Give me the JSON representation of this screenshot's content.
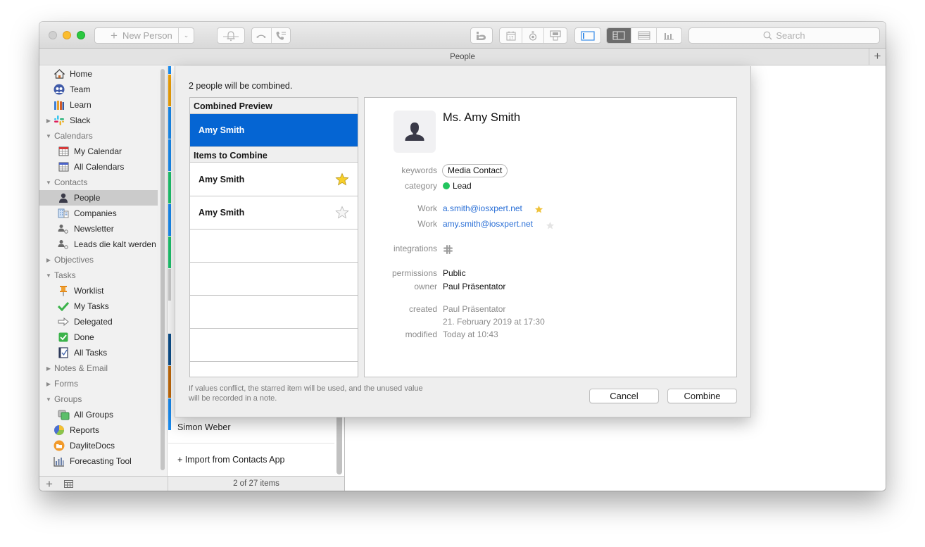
{
  "window": {
    "title": "People",
    "controls": [
      "close",
      "minimize",
      "maximize"
    ]
  },
  "toolbar": {
    "new_person_label": "New Person",
    "new_person_icon": "plus-icon",
    "dropdown_icon": "chevron-down-icon",
    "notify_icon": "bell-icon",
    "call_icons": [
      "hang-up-icon",
      "call-log-icon"
    ],
    "daylite_icon": "daylite-logo-icon",
    "action_icons": [
      "calendar-icon",
      "timer-icon",
      "sign-icon"
    ],
    "sidebar_toggle_icon": "sidebar-toggle-icon",
    "view_modes": [
      {
        "name": "detail-view",
        "icon": "split-view-icon",
        "active": true
      },
      {
        "name": "list-view",
        "icon": "list-view-icon",
        "active": false
      },
      {
        "name": "chart-view",
        "icon": "bar-chart-icon",
        "active": false
      }
    ],
    "search_placeholder": "Search"
  },
  "sidebar": {
    "items": [
      {
        "label": "Home",
        "icon": "home-icon",
        "type": "item"
      },
      {
        "label": "Team",
        "icon": "team-icon",
        "type": "item"
      },
      {
        "label": "Learn",
        "icon": "books-icon",
        "type": "item"
      },
      {
        "label": "Slack",
        "icon": "slack-icon",
        "type": "item",
        "collapsed": true
      },
      {
        "label": "Calendars",
        "type": "section",
        "expanded": true
      },
      {
        "label": "My Calendar",
        "icon": "calendar-red-icon",
        "type": "child"
      },
      {
        "label": "All Calendars",
        "icon": "calendar-blue-icon",
        "type": "child"
      },
      {
        "label": "Contacts",
        "type": "section",
        "expanded": true
      },
      {
        "label": "People",
        "icon": "person-icon",
        "type": "child",
        "selected": true
      },
      {
        "label": "Companies",
        "icon": "building-icon",
        "type": "child"
      },
      {
        "label": "Newsletter",
        "icon": "smart-list-person-icon",
        "type": "child"
      },
      {
        "label": "Leads die kalt werden",
        "icon": "smart-list-person-icon",
        "type": "child"
      },
      {
        "label": "Objectives",
        "type": "section",
        "expanded": false
      },
      {
        "label": "Tasks",
        "type": "section",
        "expanded": true
      },
      {
        "label": "Worklist",
        "icon": "pin-icon",
        "type": "child"
      },
      {
        "label": "My Tasks",
        "icon": "checkmark-icon",
        "type": "child"
      },
      {
        "label": "Delegated",
        "icon": "arrow-right-icon",
        "type": "child"
      },
      {
        "label": "Done",
        "icon": "checkbox-icon",
        "type": "child"
      },
      {
        "label": "All Tasks",
        "icon": "notebook-icon",
        "type": "child"
      },
      {
        "label": "Notes & Email",
        "type": "section",
        "expanded": false
      },
      {
        "label": "Forms",
        "type": "section",
        "expanded": false
      },
      {
        "label": "Groups",
        "type": "section",
        "expanded": true
      },
      {
        "label": "All Groups",
        "icon": "groups-icon",
        "type": "child"
      },
      {
        "label": "Reports",
        "icon": "pie-chart-icon",
        "type": "item"
      },
      {
        "label": "DayliteDocs",
        "icon": "folder-icon",
        "type": "item"
      },
      {
        "label": "Forecasting Tool",
        "icon": "forecast-icon",
        "type": "item"
      }
    ],
    "footer_icons": [
      "add-icon",
      "grid-icon"
    ]
  },
  "list": {
    "strip_colors": [
      "#1a8cf0",
      "#f0a30a",
      "#1a8cf0",
      "#1a8cf0",
      "#1fc46e",
      "#1a8cf0",
      "#1fc46e",
      "#d0d0d0",
      "#ffffff",
      "#0d4f8b",
      "#c26a0a",
      "#1a8cf0"
    ],
    "visible_rows": [
      "Simon Weber",
      "+ Import from Contacts App"
    ],
    "count_label": "2 of 27 items"
  },
  "dialog": {
    "title": "2 people will be combined.",
    "combined_preview_header": "Combined Preview",
    "combined_preview_name": "Amy Smith",
    "items_header": "Items to Combine",
    "items": [
      {
        "name": "Amy Smith",
        "starred": true
      },
      {
        "name": "Amy Smith",
        "starred": false
      }
    ],
    "detail": {
      "name": "Ms. Amy Smith",
      "avatar_icon": "person-silhouette-icon",
      "keywords_label": "keywords",
      "keywords": [
        "Media Contact"
      ],
      "category_label": "category",
      "category": "Lead",
      "category_color": "#22c55e",
      "emails": [
        {
          "label": "Work",
          "value": "a.smith@iosxpert.net",
          "starred": true
        },
        {
          "label": "Work",
          "value": "amy.smith@iosxpert.net",
          "starred": false
        }
      ],
      "integrations_label": "integrations",
      "integrations_icon": "slack-icon",
      "permissions_label": "permissions",
      "permissions": "Public",
      "owner_label": "owner",
      "owner": "Paul Präsentator",
      "created_label": "created",
      "created_by": "Paul Präsentator",
      "created_date": "21. February 2019 at 17:30",
      "modified_label": "modified",
      "modified": "Today at 10:43"
    },
    "footnote": "If values conflict, the starred item will be used, and the unused value will be recorded in a note.",
    "cancel_label": "Cancel",
    "combine_label": "Combine"
  },
  "colors": {
    "selection": "#0565d3",
    "link": "#2a6fd6",
    "star_active": "#f5c518"
  }
}
